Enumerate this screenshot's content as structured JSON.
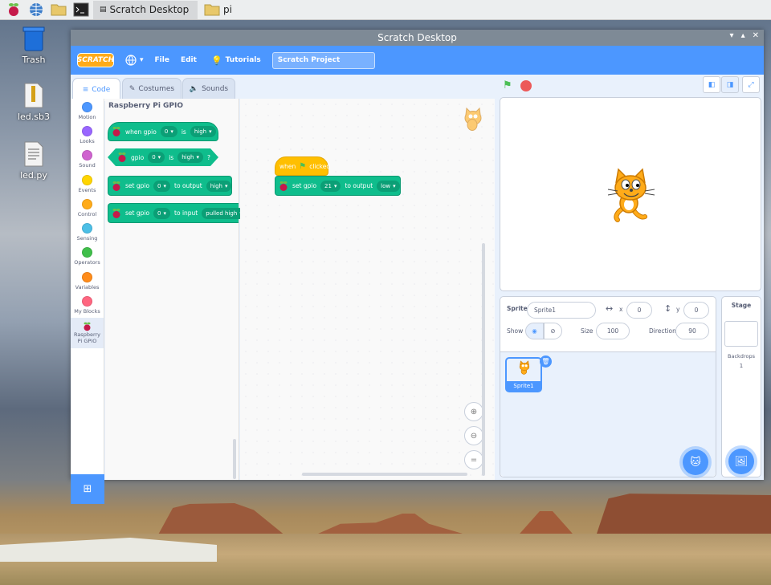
{
  "taskbar": {
    "scratch_window": "Scratch Desktop",
    "files_window": "pi"
  },
  "desktop": {
    "icons": [
      {
        "label": "Trash"
      },
      {
        "label": "led.sb3"
      },
      {
        "label": "led.py"
      }
    ]
  },
  "window": {
    "title": "Scratch Desktop"
  },
  "menu": {
    "logo": "SCRATCH",
    "file": "File",
    "edit": "Edit",
    "tutorials": "Tutorials",
    "project_title": "Scratch Project"
  },
  "tabs": {
    "code": "Code",
    "costumes": "Costumes",
    "sounds": "Sounds"
  },
  "categories": [
    {
      "label": "Motion",
      "color": "#4c97ff"
    },
    {
      "label": "Looks",
      "color": "#9966ff"
    },
    {
      "label": "Sound",
      "color": "#cf63cf"
    },
    {
      "label": "Events",
      "color": "#ffd500"
    },
    {
      "label": "Control",
      "color": "#ffab19"
    },
    {
      "label": "Sensing",
      "color": "#4cbfe6"
    },
    {
      "label": "Operators",
      "color": "#40bf4a"
    },
    {
      "label": "Variables",
      "color": "#ff8c1a"
    },
    {
      "label": "My Blocks",
      "color": "#ff6680"
    },
    {
      "label": "Raspberry Pi GPIO",
      "color": "#0fbd8c"
    }
  ],
  "palette": {
    "title": "Raspberry Pi GPIO",
    "blocks": [
      {
        "t1": "when gpio",
        "v1": "0",
        "t2": "is",
        "v2": "high"
      },
      {
        "t1": "gpio",
        "v1": "0",
        "t2": "is",
        "v2": "high",
        "t3": "?"
      },
      {
        "t1": "set gpio",
        "v1": "0",
        "t2": "to output",
        "v2": "high"
      },
      {
        "t1": "set gpio",
        "v1": "0",
        "t2": "to input",
        "v2": "pulled high"
      }
    ]
  },
  "script": {
    "hat": {
      "t1": "when",
      "t2": "clicked"
    },
    "block": {
      "t1": "set gpio",
      "v1": "21",
      "t2": "to output",
      "v2": "low"
    }
  },
  "sprite_info": {
    "sprite_label": "Sprite",
    "sprite_name": "Sprite1",
    "x_label": "x",
    "x": "0",
    "y_label": "y",
    "y": "0",
    "show_label": "Show",
    "size_label": "Size",
    "size": "100",
    "direction_label": "Direction",
    "direction": "90",
    "thumb_name": "Sprite1"
  },
  "stage_panel": {
    "title": "Stage",
    "backdrops_label": "Backdrops",
    "backdrops_count": "1"
  }
}
